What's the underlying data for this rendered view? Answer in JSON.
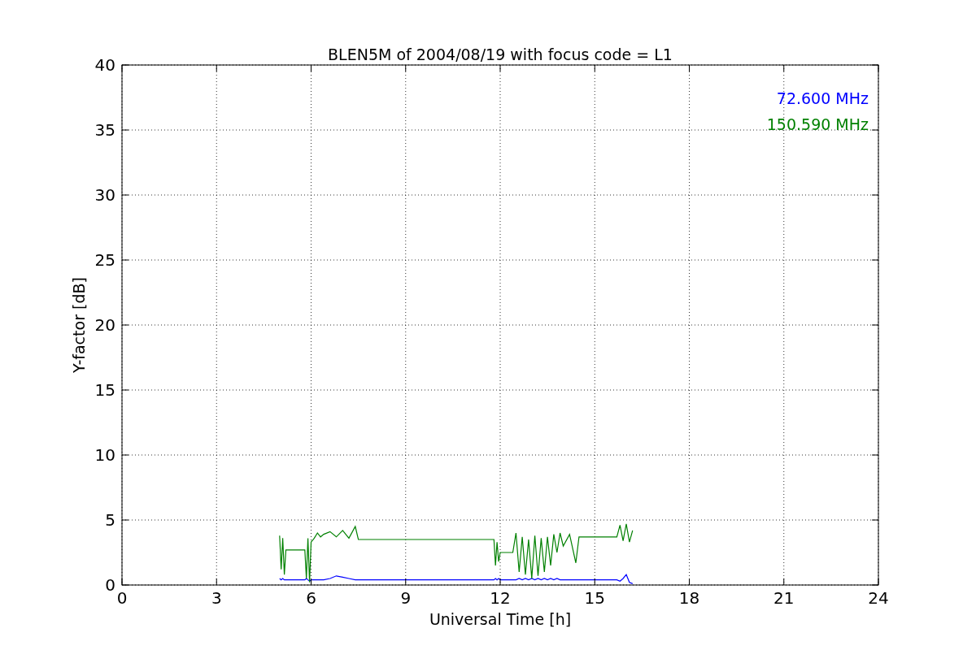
{
  "chart_data": {
    "type": "line",
    "title": "BLEN5M of 2004/08/19 with focus code = L1",
    "xlabel": "Universal Time [h]",
    "ylabel": "Y-factor [dB]",
    "x": [
      5.0,
      5.05,
      5.1,
      5.15,
      5.2,
      5.8,
      5.85,
      5.9,
      5.95,
      6.0,
      6.1,
      6.2,
      6.3,
      6.4,
      6.6,
      6.8,
      7.0,
      7.2,
      7.4,
      7.5,
      11.8,
      11.85,
      11.9,
      11.95,
      12.0,
      12.4,
      12.5,
      12.6,
      12.7,
      12.8,
      12.9,
      13.0,
      13.1,
      13.2,
      13.3,
      13.4,
      13.5,
      13.6,
      13.7,
      13.8,
      13.9,
      14.0,
      14.2,
      14.4,
      14.5,
      15.7,
      15.8,
      15.9,
      16.0,
      16.1,
      16.2
    ],
    "series": [
      {
        "name": "72.600 MHz",
        "color": "#0000ff",
        "values": [
          0.5,
          0.4,
          0.5,
          0.4,
          0.4,
          0.4,
          0.5,
          0.4,
          0.3,
          0.4,
          0.4,
          0.4,
          0.4,
          0.4,
          0.5,
          0.7,
          0.6,
          0.5,
          0.4,
          0.4,
          0.4,
          0.5,
          0.4,
          0.5,
          0.4,
          0.4,
          0.4,
          0.5,
          0.4,
          0.5,
          0.4,
          0.5,
          0.4,
          0.5,
          0.4,
          0.5,
          0.4,
          0.5,
          0.4,
          0.5,
          0.4,
          0.4,
          0.4,
          0.4,
          0.4,
          0.4,
          0.3,
          0.5,
          0.8,
          0.2,
          0.1
        ]
      },
      {
        "name": "150.590 MHz",
        "color": "#008000",
        "values": [
          3.8,
          1.2,
          3.6,
          0.8,
          2.7,
          2.7,
          0.5,
          3.6,
          0.2,
          3.3,
          3.6,
          4.0,
          3.7,
          3.9,
          4.1,
          3.7,
          4.2,
          3.6,
          4.5,
          3.5,
          3.5,
          1.5,
          3.3,
          1.8,
          2.5,
          2.5,
          4.0,
          1.0,
          3.7,
          0.8,
          3.5,
          0.5,
          3.8,
          0.7,
          3.6,
          1.0,
          3.7,
          1.5,
          3.9,
          2.5,
          4.0,
          3.0,
          3.9,
          1.7,
          3.7,
          3.7,
          4.6,
          3.4,
          4.7,
          3.3,
          4.2
        ]
      }
    ],
    "grid": true,
    "xlim": [
      0,
      24
    ],
    "ylim": [
      0,
      40
    ],
    "xticks": [
      0,
      3,
      6,
      9,
      12,
      15,
      18,
      21,
      24
    ],
    "yticks": [
      0,
      5,
      10,
      15,
      20,
      25,
      30,
      35,
      40
    ]
  }
}
